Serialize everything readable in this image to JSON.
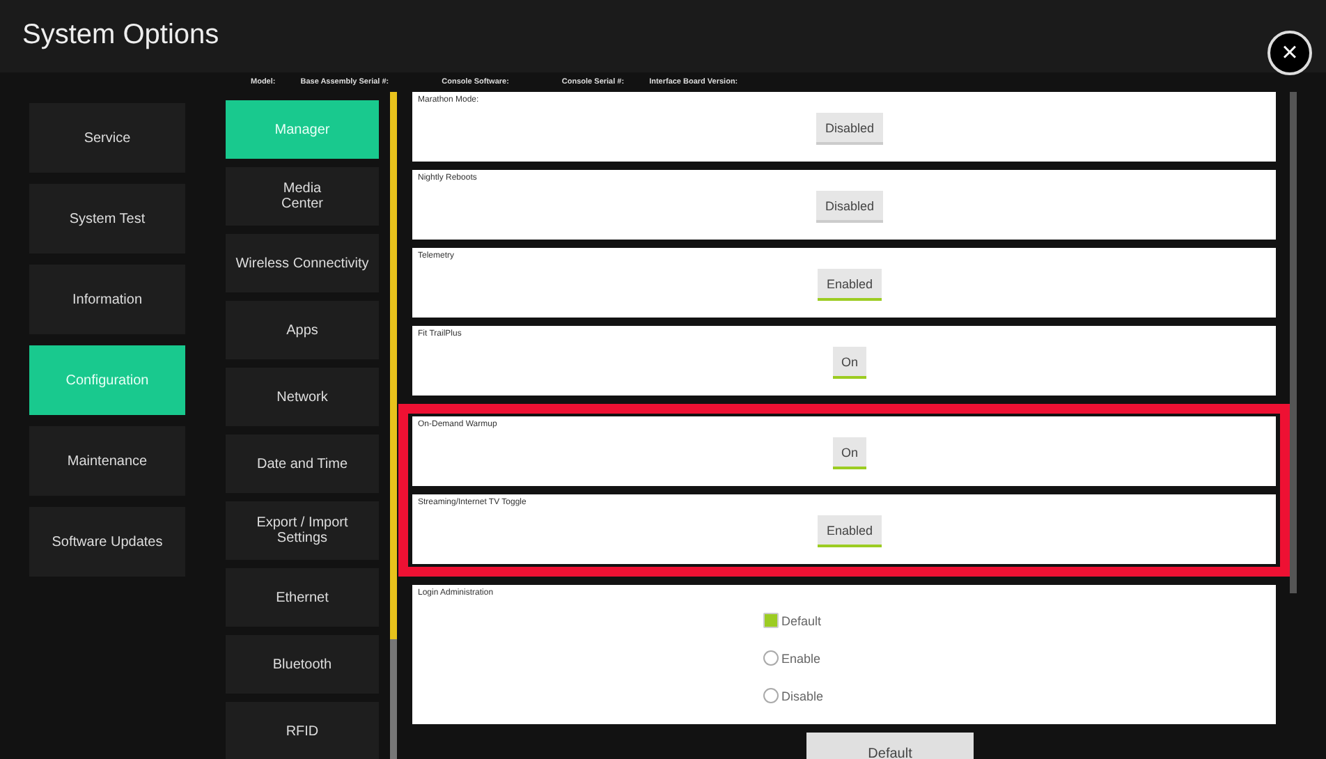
{
  "window": {
    "title": "System Options",
    "close": "×"
  },
  "info_labels": [
    "Model:",
    "Base Assembly Serial #:",
    "Console Software:",
    "Console Serial #:",
    "Interface Board Version:"
  ],
  "main_menu": [
    {
      "label": "Service",
      "selected": false
    },
    {
      "label": "System Test",
      "selected": false
    },
    {
      "label": "Information",
      "selected": false
    },
    {
      "label": "Configuration",
      "selected": true
    },
    {
      "label": "Maintenance",
      "selected": false
    },
    {
      "label": "Software Updates",
      "selected": false
    }
  ],
  "sub_menu": [
    {
      "label": "Manager",
      "selected": true
    },
    {
      "label": "Media\nCenter",
      "selected": false
    },
    {
      "label": "Wireless Connectivity",
      "selected": false
    },
    {
      "label": "Apps",
      "selected": false
    },
    {
      "label": "Network",
      "selected": false
    },
    {
      "label": "Date and Time",
      "selected": false
    },
    {
      "label": "Export / Import\nSettings",
      "selected": false
    },
    {
      "label": "Ethernet",
      "selected": false
    },
    {
      "label": "Bluetooth",
      "selected": false
    },
    {
      "label": "RFID",
      "selected": false
    }
  ],
  "setting_groups": [
    {
      "highlighted": false,
      "settings": [
        {
          "kind": "toggle",
          "label": "Marathon Mode:",
          "value": "Disabled",
          "on": false
        },
        {
          "kind": "toggle",
          "label": "Nightly Reboots",
          "value": "Disabled",
          "on": false
        },
        {
          "kind": "toggle",
          "label": "Telemetry",
          "value": "Enabled",
          "on": true
        },
        {
          "kind": "toggle",
          "label": "Fit TrailPlus",
          "value": "On",
          "on": true
        }
      ]
    },
    {
      "highlighted": true,
      "settings": [
        {
          "kind": "toggle",
          "label": "On-Demand Warmup",
          "value": "On",
          "on": true
        },
        {
          "kind": "toggle",
          "label": "Streaming/Internet TV Toggle",
          "value": "Enabled",
          "on": true
        }
      ]
    },
    {
      "highlighted": false,
      "settings": [
        {
          "kind": "radio",
          "label": "Login Administration",
          "options": [
            {
              "label": "Default",
              "selected": true
            },
            {
              "label": "Enable",
              "selected": false
            },
            {
              "label": "Disable",
              "selected": false
            }
          ]
        }
      ]
    }
  ],
  "default_button": "Default"
}
